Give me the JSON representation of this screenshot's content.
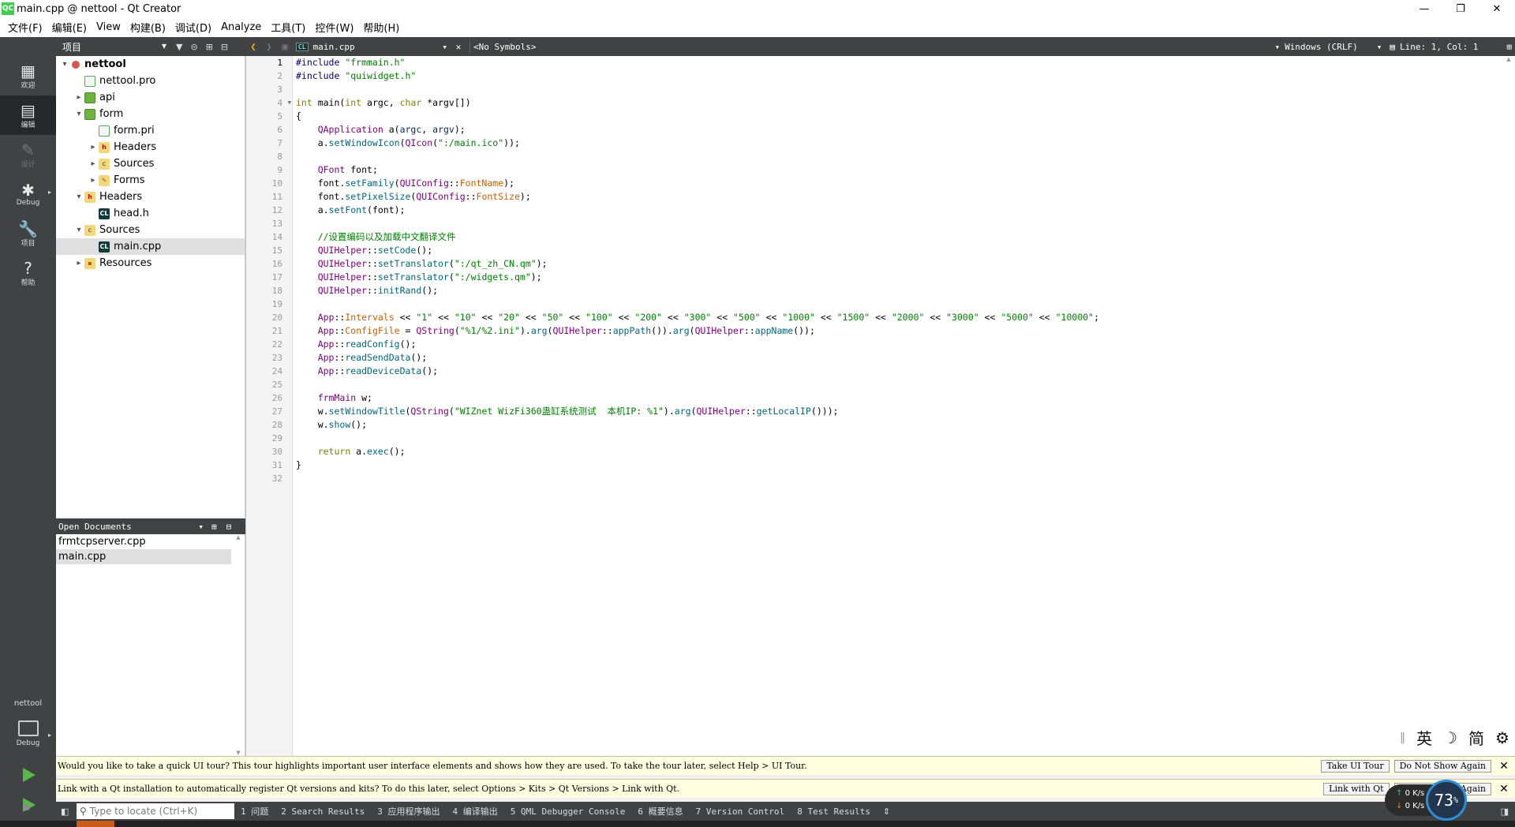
{
  "window": {
    "title": "main.cpp @ nettool - Qt Creator",
    "app_icon": "QC",
    "controls": [
      "—",
      "❐",
      "✕"
    ]
  },
  "menu": [
    "文件(F)",
    "编辑(E)",
    "View",
    "构建(B)",
    "调试(D)",
    "Analyze",
    "工具(T)",
    "控件(W)",
    "帮助(H)"
  ],
  "modes": [
    {
      "label": "欢迎",
      "icon": "grid-icon"
    },
    {
      "label": "编辑",
      "icon": "edit-icon"
    },
    {
      "label": "设计",
      "icon": "pencil-icon"
    },
    {
      "label": "Debug",
      "icon": "bug-icon"
    },
    {
      "label": "项目",
      "icon": "wrench-icon"
    },
    {
      "label": "帮助",
      "icon": "help-icon"
    }
  ],
  "kit": {
    "project": "nettool",
    "config": "Debug"
  },
  "navigation": {
    "view_label": "项目"
  },
  "project_tree": [
    {
      "label": "nettool",
      "level": 0,
      "expander": "▾",
      "icon": "proj",
      "bold": true
    },
    {
      "label": "nettool.pro",
      "level": 1,
      "expander": "",
      "icon": "pro"
    },
    {
      "label": "api",
      "level": 1,
      "expander": "▸",
      "icon": "folder"
    },
    {
      "label": "form",
      "level": 1,
      "expander": "▾",
      "icon": "folder"
    },
    {
      "label": "form.pri",
      "level": 2,
      "expander": "",
      "icon": "pro"
    },
    {
      "label": "Headers",
      "level": 2,
      "expander": "▸",
      "icon": "hfolder"
    },
    {
      "label": "Sources",
      "level": 2,
      "expander": "▸",
      "icon": "cfolder"
    },
    {
      "label": "Forms",
      "level": 2,
      "expander": "▸",
      "icon": "formf"
    },
    {
      "label": "Headers",
      "level": 1,
      "expander": "▾",
      "icon": "hfolder"
    },
    {
      "label": "head.h",
      "level": 2,
      "expander": "",
      "icon": "cfile"
    },
    {
      "label": "Sources",
      "level": 1,
      "expander": "▾",
      "icon": "cfolder"
    },
    {
      "label": "main.cpp",
      "level": 2,
      "expander": "",
      "icon": "cfile",
      "selected": true
    },
    {
      "label": "Resources",
      "level": 1,
      "expander": "▸",
      "icon": "resf"
    }
  ],
  "open_documents": {
    "header": "Open Documents",
    "items": [
      {
        "label": "frmtcpserver.cpp",
        "selected": false
      },
      {
        "label": "main.cpp",
        "selected": true
      }
    ]
  },
  "editor_toolbar": {
    "document": "main.cpp",
    "symbols": "<No Symbols>",
    "line_ending": "Windows (CRLF)",
    "position": "Line: 1, Col: 1"
  },
  "editor": {
    "current_line": 1,
    "lines": [
      [
        [
          "#include ",
          "#000080"
        ],
        [
          "\"frmmain.h\"",
          "#008000"
        ]
      ],
      [
        [
          "#include ",
          "#000080"
        ],
        [
          "\"quiwidget.h\"",
          "#008000"
        ]
      ],
      [],
      [
        [
          "int",
          "#808000"
        ],
        [
          " main(",
          "#000"
        ],
        [
          "int",
          "#808000"
        ],
        [
          " argc, ",
          "#000"
        ],
        [
          "char",
          "#808000"
        ],
        [
          " *",
          "#000"
        ],
        [
          "argv",
          "#000"
        ],
        [
          "[])",
          "#000"
        ]
      ],
      [
        [
          "{",
          "#000"
        ]
      ],
      [
        [
          "    ",
          "#000"
        ],
        [
          "QApplication",
          "#800080"
        ],
        [
          " a(",
          "#000"
        ],
        [
          "argc",
          "#092e64"
        ],
        [
          ", ",
          "#000"
        ],
        [
          "argv",
          "#092e64"
        ],
        [
          ");",
          "#000"
        ]
      ],
      [
        [
          "    a.",
          "#000"
        ],
        [
          "setWindowIcon",
          "#00677c"
        ],
        [
          "(",
          "#000"
        ],
        [
          "QIcon",
          "#800080"
        ],
        [
          "(",
          "#000"
        ],
        [
          "\":/main.ico\"",
          "#008000"
        ],
        [
          "));",
          "#000"
        ]
      ],
      [],
      [
        [
          "    ",
          "#000"
        ],
        [
          "QFont",
          "#800080"
        ],
        [
          " font;",
          "#000"
        ]
      ],
      [
        [
          "    font.",
          "#000"
        ],
        [
          "setFamily",
          "#00677c"
        ],
        [
          "(",
          "#000"
        ],
        [
          "QUIConfig",
          "#800080"
        ],
        [
          "::",
          "#000"
        ],
        [
          "FontName",
          "#ce5c00"
        ],
        [
          ");",
          "#000"
        ]
      ],
      [
        [
          "    font.",
          "#000"
        ],
        [
          "setPixelSize",
          "#00677c"
        ],
        [
          "(",
          "#000"
        ],
        [
          "QUIConfig",
          "#800080"
        ],
        [
          "::",
          "#000"
        ],
        [
          "FontSize",
          "#ce5c00"
        ],
        [
          ");",
          "#000"
        ]
      ],
      [
        [
          "    a.",
          "#000"
        ],
        [
          "setFont",
          "#00677c"
        ],
        [
          "(font);",
          "#000"
        ]
      ],
      [],
      [
        [
          "    //设置编码以及加载中文翻译文件",
          "#008000"
        ]
      ],
      [
        [
          "    ",
          "#000"
        ],
        [
          "QUIHelper",
          "#800080"
        ],
        [
          "::",
          "#000"
        ],
        [
          "setCode",
          "#00677c"
        ],
        [
          "();",
          "#000"
        ]
      ],
      [
        [
          "    ",
          "#000"
        ],
        [
          "QUIHelper",
          "#800080"
        ],
        [
          "::",
          "#000"
        ],
        [
          "setTranslator",
          "#00677c"
        ],
        [
          "(",
          "#000"
        ],
        [
          "\":/qt_zh_CN.qm\"",
          "#008000"
        ],
        [
          ");",
          "#000"
        ]
      ],
      [
        [
          "    ",
          "#000"
        ],
        [
          "QUIHelper",
          "#800080"
        ],
        [
          "::",
          "#000"
        ],
        [
          "setTranslator",
          "#00677c"
        ],
        [
          "(",
          "#000"
        ],
        [
          "\":/widgets.qm\"",
          "#008000"
        ],
        [
          ");",
          "#000"
        ]
      ],
      [
        [
          "    ",
          "#000"
        ],
        [
          "QUIHelper",
          "#800080"
        ],
        [
          "::",
          "#000"
        ],
        [
          "initRand",
          "#00677c"
        ],
        [
          "();",
          "#000"
        ]
      ],
      [],
      [
        [
          "    ",
          "#000"
        ],
        [
          "App",
          "#800080"
        ],
        [
          "::",
          "#000"
        ],
        [
          "Intervals",
          "#ce5c00"
        ],
        [
          " << ",
          "#000"
        ],
        [
          "\"1\"",
          "#008000"
        ],
        [
          " << ",
          "#000"
        ],
        [
          "\"10\"",
          "#008000"
        ],
        [
          " << ",
          "#000"
        ],
        [
          "\"20\"",
          "#008000"
        ],
        [
          " << ",
          "#000"
        ],
        [
          "\"50\"",
          "#008000"
        ],
        [
          " << ",
          "#000"
        ],
        [
          "\"100\"",
          "#008000"
        ],
        [
          " << ",
          "#000"
        ],
        [
          "\"200\"",
          "#008000"
        ],
        [
          " << ",
          "#000"
        ],
        [
          "\"300\"",
          "#008000"
        ],
        [
          " << ",
          "#000"
        ],
        [
          "\"500\"",
          "#008000"
        ],
        [
          " << ",
          "#000"
        ],
        [
          "\"1000\"",
          "#008000"
        ],
        [
          " << ",
          "#000"
        ],
        [
          "\"1500\"",
          "#008000"
        ],
        [
          " << ",
          "#000"
        ],
        [
          "\"2000\"",
          "#008000"
        ],
        [
          " << ",
          "#000"
        ],
        [
          "\"3000\"",
          "#008000"
        ],
        [
          " << ",
          "#000"
        ],
        [
          "\"5000\"",
          "#008000"
        ],
        [
          " << ",
          "#000"
        ],
        [
          "\"10000\"",
          "#008000"
        ],
        [
          ";",
          "#000"
        ]
      ],
      [
        [
          "    ",
          "#000"
        ],
        [
          "App",
          "#800080"
        ],
        [
          "::",
          "#000"
        ],
        [
          "ConfigFile",
          "#ce5c00"
        ],
        [
          " = ",
          "#000"
        ],
        [
          "QString",
          "#800080"
        ],
        [
          "(",
          "#000"
        ],
        [
          "\"%1/%2.ini\"",
          "#008000"
        ],
        [
          ").",
          "#000"
        ],
        [
          "arg",
          "#00677c"
        ],
        [
          "(",
          "#000"
        ],
        [
          "QUIHelper",
          "#800080"
        ],
        [
          "::",
          "#000"
        ],
        [
          "appPath",
          "#00677c"
        ],
        [
          "()).",
          "#000"
        ],
        [
          "arg",
          "#00677c"
        ],
        [
          "(",
          "#000"
        ],
        [
          "QUIHelper",
          "#800080"
        ],
        [
          "::",
          "#000"
        ],
        [
          "appName",
          "#00677c"
        ],
        [
          "());",
          "#000"
        ]
      ],
      [
        [
          "    ",
          "#000"
        ],
        [
          "App",
          "#800080"
        ],
        [
          "::",
          "#000"
        ],
        [
          "readConfig",
          "#00677c"
        ],
        [
          "();",
          "#000"
        ]
      ],
      [
        [
          "    ",
          "#000"
        ],
        [
          "App",
          "#800080"
        ],
        [
          "::",
          "#000"
        ],
        [
          "readSendData",
          "#00677c"
        ],
        [
          "();",
          "#000"
        ]
      ],
      [
        [
          "    ",
          "#000"
        ],
        [
          "App",
          "#800080"
        ],
        [
          "::",
          "#000"
        ],
        [
          "readDeviceData",
          "#00677c"
        ],
        [
          "();",
          "#000"
        ]
      ],
      [],
      [
        [
          "    ",
          "#000"
        ],
        [
          "frmMain",
          "#800080"
        ],
        [
          " w;",
          "#000"
        ]
      ],
      [
        [
          "    w.",
          "#000"
        ],
        [
          "setWindowTitle",
          "#00677c"
        ],
        [
          "(",
          "#000"
        ],
        [
          "QString",
          "#800080"
        ],
        [
          "(",
          "#000"
        ],
        [
          "\"WIZnet WizFi360蛊缸系统测试  本机IP: %1\"",
          "#008000"
        ],
        [
          ").",
          "#000"
        ],
        [
          "arg",
          "#00677c"
        ],
        [
          "(",
          "#000"
        ],
        [
          "QUIHelper",
          "#800080"
        ],
        [
          "::",
          "#000"
        ],
        [
          "getLocalIP",
          "#00677c"
        ],
        [
          "()));",
          "#000"
        ]
      ],
      [
        [
          "    w.",
          "#000"
        ],
        [
          "show",
          "#00677c"
        ],
        [
          "();",
          "#000"
        ]
      ],
      [],
      [
        [
          "    ",
          "#000"
        ],
        [
          "return",
          "#808000"
        ],
        [
          " a.",
          "#000"
        ],
        [
          "exec",
          "#00677c"
        ],
        [
          "();",
          "#000"
        ]
      ],
      [
        [
          "}",
          "#000"
        ]
      ],
      []
    ]
  },
  "infobars": [
    {
      "message": "Would you like to take a quick UI tour? This tour highlights important user interface elements and shows how they are used. To take the tour later, select Help > UI Tour.",
      "buttons": [
        "Take UI Tour",
        "Do Not Show Again"
      ]
    },
    {
      "message": "Link with a Qt installation to automatically register Qt versions and kits? To do this later, select Options > Kits > Qt Versions > Link with Qt.",
      "buttons": [
        "Link with Qt",
        "Do Not Show Again"
      ]
    }
  ],
  "statusbar": {
    "locator_placeholder": "Type to locate (Ctrl+K)",
    "tabs": [
      "1 问题",
      "2 Search Results",
      "3 应用程序输出",
      "4 编译输出",
      "5 QML Debugger Console",
      "6 概要信息",
      "7 Version Control",
      "8 Test Results"
    ]
  },
  "ime": [
    "英",
    "☽",
    "简",
    "⚙"
  ],
  "netwidget": {
    "up": "0 K/s",
    "down": "0 K/s",
    "percent": "73",
    "unit": "%"
  }
}
